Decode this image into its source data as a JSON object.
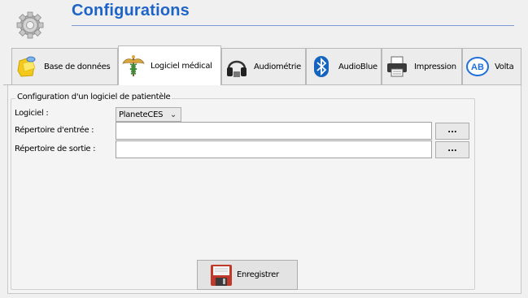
{
  "header": {
    "title": "Configurations",
    "icon": "gear-icon"
  },
  "tabs": [
    {
      "label": "Base de données",
      "icon": "database-icon",
      "active": false
    },
    {
      "label": "Logiciel médical",
      "icon": "caduceus-icon",
      "active": true
    },
    {
      "label": "Audiométrie",
      "icon": "headphones-icon",
      "active": false
    },
    {
      "label": "AudioBlue",
      "icon": "bluetooth-icon",
      "active": false
    },
    {
      "label": "Impression",
      "icon": "printer-icon",
      "active": false
    },
    {
      "label": "Volta",
      "icon": "ab-logo-icon",
      "active": false
    }
  ],
  "group": {
    "title": "Configuration d'un logiciel de patientèle",
    "software_label": "Logiciel :",
    "software_value": "PlaneteCES",
    "input_dir_label": "Répertoire d'entrée :",
    "input_dir_value": "",
    "output_dir_label": "Répertoire de sortie :",
    "output_dir_value": "",
    "browse_label": "..."
  },
  "save_button": {
    "label": "Enregistrer",
    "icon": "floppy-disk-icon"
  },
  "colors": {
    "title": "#1e64c8",
    "title_rule": "#7d9ad6",
    "background": "#f0f0f0",
    "bluetooth": "#1565c0",
    "volta": "#1e6fd8"
  }
}
